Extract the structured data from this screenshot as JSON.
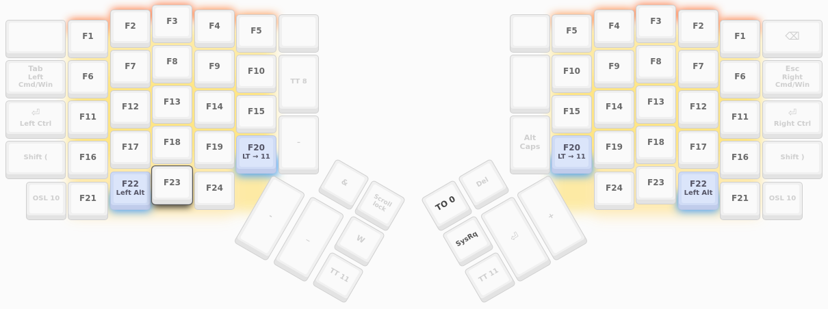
{
  "keyboard": {
    "left_hand": {
      "row1": {
        "f1": "F1",
        "f2": "F2",
        "f3": "F3",
        "f4": "F4",
        "f5": "F5"
      },
      "row2": {
        "tab": "Tab",
        "tab_sub1": "Left",
        "tab_sub2": "Cmd/Win",
        "f6": "F6",
        "f7": "F7",
        "f8": "F8",
        "f9": "F9",
        "f10": "F10",
        "tt8": "TT 8"
      },
      "row3": {
        "enter_icon": "return-icon",
        "ctrl": "Left Ctrl",
        "f11": "F11",
        "f12": "F12",
        "f13": "F13",
        "f14": "F14",
        "f15": "F15",
        "dash": "–"
      },
      "row4": {
        "shift": "Shift (",
        "f16": "F16",
        "f17": "F17",
        "f18": "F18",
        "f19": "F19",
        "f20": "F20",
        "f20_sub": "LT → 11"
      },
      "row5": {
        "osl": "OSL 10",
        "f21": "F21",
        "f22": "F22",
        "f22_sub": "Left Alt",
        "f23": "F23",
        "f24": "F24"
      },
      "thumb": {
        "amp": "&",
        "scroll": "Scroll lock",
        "w": "W",
        "tt11": "TT 11",
        "big1": "-",
        "big2": "_"
      }
    },
    "right_hand": {
      "row1": {
        "f5": "F5",
        "f4": "F4",
        "f3": "F3",
        "f2": "F2",
        "f1": "F1",
        "backspace_icon": "backspace-icon"
      },
      "row2": {
        "f10": "F10",
        "f9": "F9",
        "f8": "F8",
        "f7": "F7",
        "f6": "F6",
        "esc": "Esc",
        "esc_sub1": "Right",
        "esc_sub2": "Cmd/Win"
      },
      "row3": {
        "f15": "F15",
        "f14": "F14",
        "f13": "F13",
        "f12": "F12",
        "f11": "F11",
        "enter_icon": "return-icon",
        "ctrl": "Right Ctrl"
      },
      "row4": {
        "alt": "Alt",
        "caps": "Caps",
        "f20": "F20",
        "f20_sub": "LT → 11",
        "f19": "F19",
        "f18": "F18",
        "f17": "F17",
        "f16": "F16",
        "shift": "Shift )"
      },
      "row5": {
        "f24": "F24",
        "f23": "F23",
        "f22": "F22",
        "f22_sub": "Left Alt",
        "f21": "F21",
        "osl": "OSL 10"
      },
      "thumb": {
        "to0": "TO 0",
        "del": "Del",
        "sysrq": "SysRq",
        "tt11": "TT 11",
        "big_enter_icon": "return-icon",
        "plus": "+"
      }
    }
  },
  "colors": {
    "glow_hot": "#ff6a2c",
    "glow_warm": "#ffcc33",
    "glow_faint": "#ffe7b8",
    "glow_blue": "#3f9dff",
    "key_alt_bg": "#cfdbf5"
  }
}
